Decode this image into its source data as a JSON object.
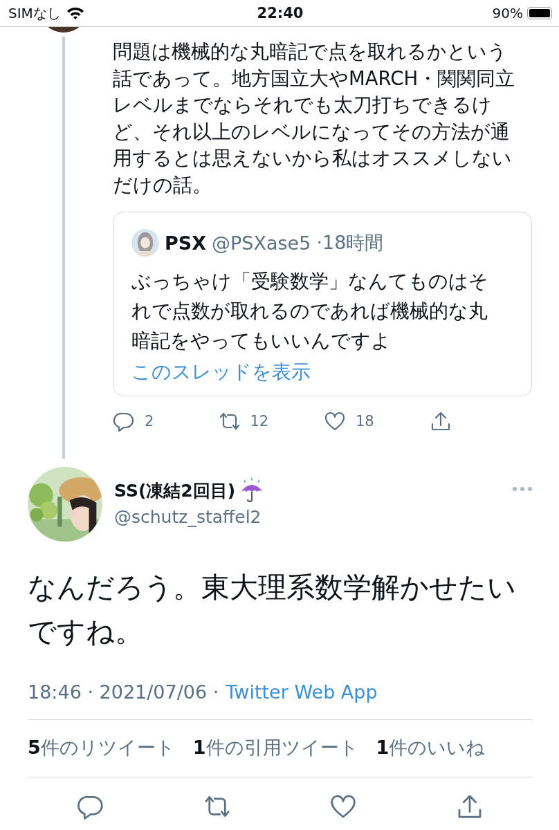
{
  "status_bar": {
    "carrier": "SIMなし",
    "time": "22:40",
    "battery": "90%"
  },
  "parent_tweet": {
    "text": "問題は機械的な丸暗記で点を取れるかという話であって。地方国立大やMARCH・関関同立レベルまでならそれでも太刀打ちできるけど、それ以上のレベルになってその方法が通用するとは思えないから私はオススメしないだけの話。",
    "quote": {
      "name": "PSX",
      "handle": "@PSXase5",
      "time": "·18時間",
      "text": "ぶっちゃけ「受験数学」なんてものはそれで点数が取れるのであれば機械的な丸暗記をやってもいいんですよ",
      "link": "このスレッドを表示"
    },
    "actions": [
      {
        "kind": "reply",
        "count": "2"
      },
      {
        "kind": "retweet",
        "count": "12"
      },
      {
        "kind": "like",
        "count": "18"
      },
      {
        "kind": "share"
      }
    ]
  },
  "tweet": {
    "name": "SS(凍結2回目)",
    "handle": "@schutz_staffel2",
    "text": "なんだろう。東大理系数学解かせたいですね。",
    "meta": "18:46 · 2021/07/06 ·",
    "source": "Twitter Web App",
    "stats": [
      "**5**件のリツイート",
      "**1**件の引用ツイート",
      "**1**件のいいね"
    ],
    "actions": [
      {
        "kind": "reply"
      },
      {
        "kind": "retweet"
      },
      {
        "kind": "like"
      },
      {
        "kind": "share"
      }
    ]
  }
}
